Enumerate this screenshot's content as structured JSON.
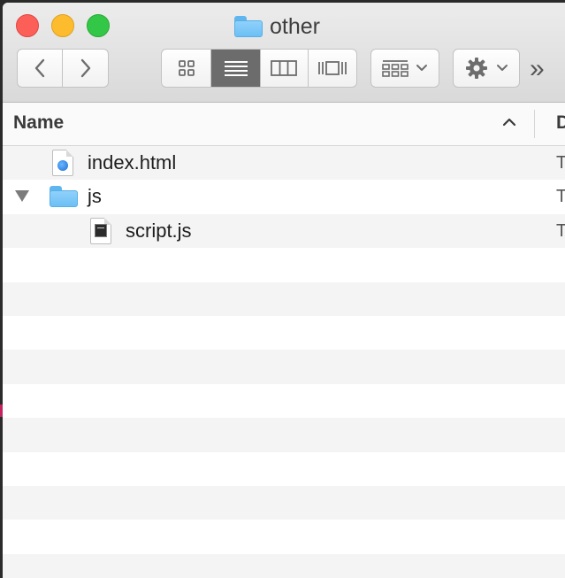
{
  "window": {
    "title": "other",
    "folder_icon": "folder-icon"
  },
  "toolbar": {
    "back_icon": "chevron-left-icon",
    "forward_icon": "chevron-right-icon",
    "view_modes": [
      {
        "name": "icon-view",
        "icon": "grid-icon",
        "active": false
      },
      {
        "name": "list-view",
        "icon": "list-icon",
        "active": true
      },
      {
        "name": "column-view",
        "icon": "columns-icon",
        "active": false
      },
      {
        "name": "gallery-view",
        "icon": "gallery-icon",
        "active": false
      }
    ],
    "arrange_icon": "arrange-icon",
    "action_icon": "gear-icon",
    "overflow_label": "»"
  },
  "columns": {
    "name_label": "Name",
    "next_column_label": "D",
    "sort_icon": "chevron-up-icon"
  },
  "files": [
    {
      "name": "index.html",
      "icon": "html-document-icon",
      "level": 1,
      "expanded": null,
      "trail": "T"
    },
    {
      "name": "js",
      "icon": "folder-icon",
      "level": 0,
      "expanded": true,
      "trail": "T"
    },
    {
      "name": "script.js",
      "icon": "script-document-icon",
      "level": 2,
      "expanded": null,
      "trail": "T"
    }
  ],
  "empty_rows": 10,
  "colors": {
    "selected_segment": "#6c6c6c",
    "row_alt": "#f4f4f4",
    "folder": "#78c5f7"
  }
}
